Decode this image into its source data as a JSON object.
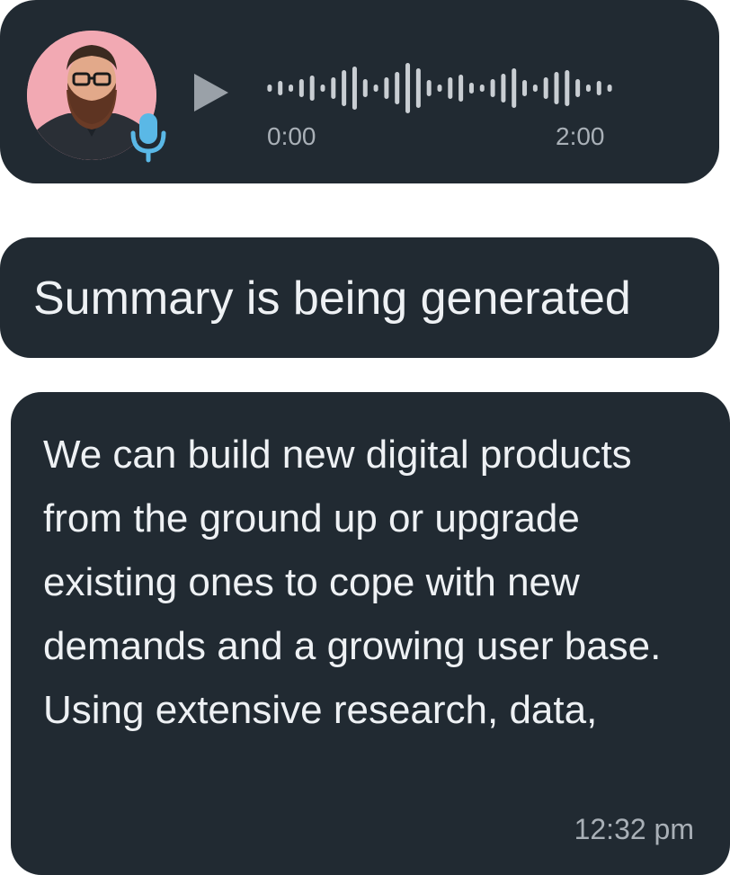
{
  "voice_message": {
    "avatar_icon": "user-avatar-photo",
    "mic_icon": "microphone-icon",
    "play_icon": "play-icon",
    "current_time": "0:00",
    "duration": "2:00",
    "progress": 0,
    "colors": {
      "bubble": "#212a32",
      "avatar_bg": "#f2a9b3",
      "mic": "#5ab8e6",
      "play": "#9aa1a8",
      "wave": "#c9ced3"
    }
  },
  "summary": {
    "text": "Summary is being generated"
  },
  "message": {
    "text": "We can build new digital products from the ground up or upgrade existing ones to cope with new demands and a growing user base. Using extensive research, data,",
    "time": "12:32 pm"
  }
}
